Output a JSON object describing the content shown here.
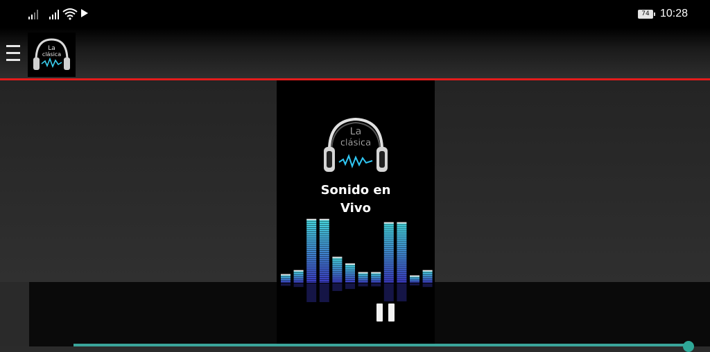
{
  "status_bar": {
    "battery_level": "74",
    "time": "10:28"
  },
  "app_bar": {
    "logo_text_line1": "La",
    "logo_text_line2": "clásica"
  },
  "player": {
    "logo_text_line1": "La",
    "logo_text_line2": "clásica",
    "title": "Sonido en Vivo",
    "state": "playing"
  },
  "colors": {
    "accent_line": "#e51b1b",
    "progress": "#2fa898",
    "viz_top": "#48e0e8",
    "viz_bottom": "#3d3dc8"
  },
  "visualizer": {
    "levels": [
      0.12,
      0.18,
      0.95,
      0.95,
      0.38,
      0.28,
      0.15,
      0.15,
      0.9,
      0.9,
      0.1,
      0.18
    ]
  }
}
